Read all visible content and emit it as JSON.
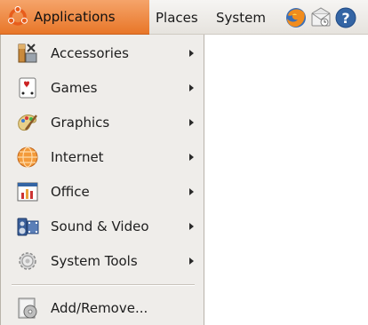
{
  "panel": {
    "menus": [
      {
        "label": "Applications",
        "icon": "ubuntu-logo-icon"
      },
      {
        "label": "Places"
      },
      {
        "label": "System"
      }
    ],
    "launchers": [
      {
        "icon": "firefox-icon"
      },
      {
        "icon": "mail-icon"
      },
      {
        "icon": "help-icon"
      }
    ]
  },
  "applications_menu": {
    "items": [
      {
        "label": "Accessories",
        "icon": "accessories-icon",
        "submenu": true
      },
      {
        "label": "Games",
        "icon": "games-icon",
        "submenu": true
      },
      {
        "label": "Graphics",
        "icon": "graphics-icon",
        "submenu": true
      },
      {
        "label": "Internet",
        "icon": "internet-icon",
        "submenu": true
      },
      {
        "label": "Office",
        "icon": "office-icon",
        "submenu": true
      },
      {
        "label": "Sound & Video",
        "icon": "sound-video-icon",
        "submenu": true
      },
      {
        "label": "System Tools",
        "icon": "system-tools-icon",
        "submenu": true
      }
    ],
    "footer_items": [
      {
        "label": "Add/Remove...",
        "icon": "add-remove-icon",
        "submenu": false
      }
    ]
  },
  "colors": {
    "panel_bg": "#ebe8e4",
    "active_menu": "#e87628",
    "menu_bg": "#efedea"
  }
}
